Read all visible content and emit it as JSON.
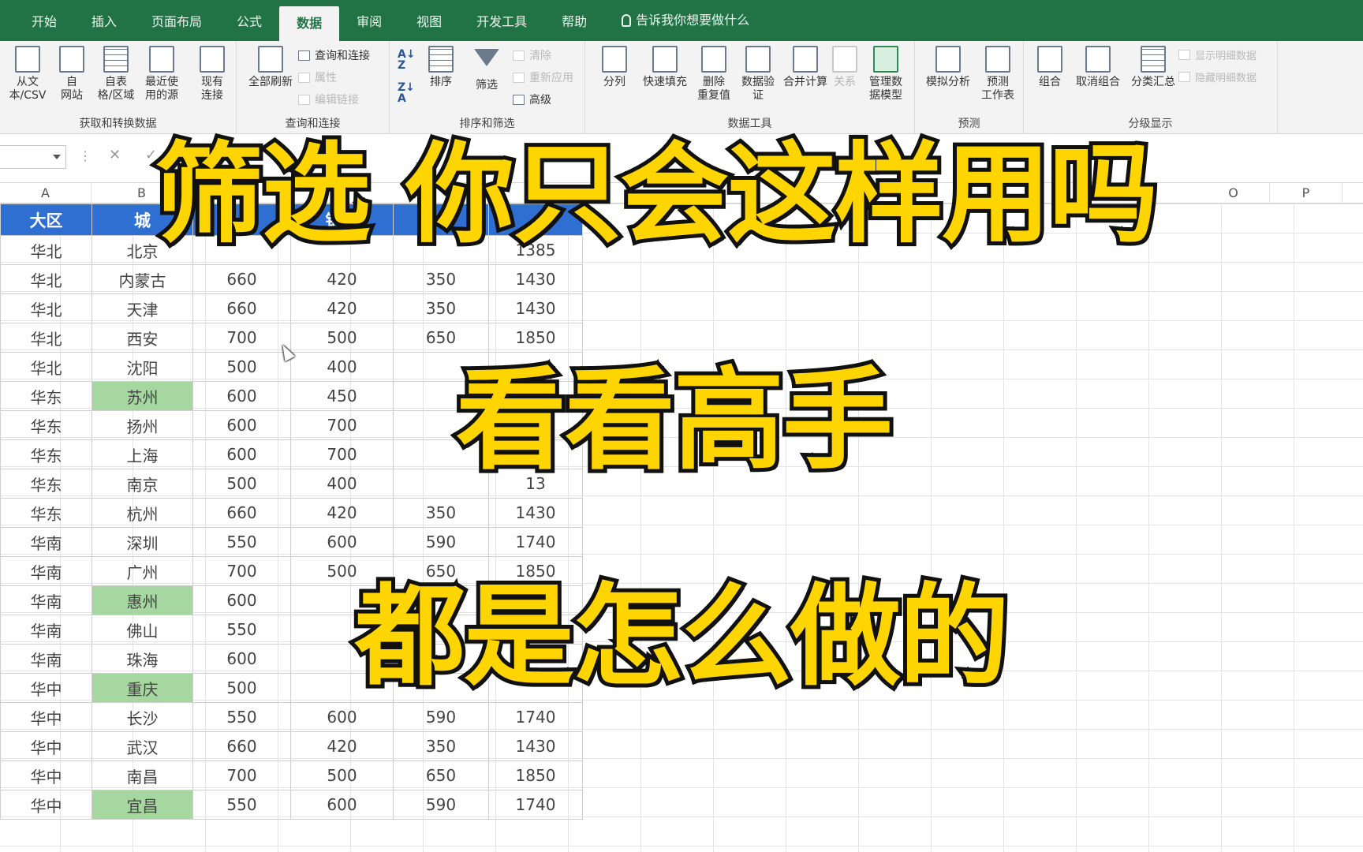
{
  "ribbon_tabs": [
    "开始",
    "插入",
    "页面布局",
    "公式",
    "数据",
    "审阅",
    "视图",
    "开发工具",
    "帮助"
  ],
  "tell_me": "告诉我你想要做什么",
  "ribbon": {
    "get_data": {
      "label": "获取和转换数据",
      "b1": "从文\n本/CSV",
      "b2": "自\n网站",
      "b3": "自表\n格/区域",
      "b4": "最近使\n用的源",
      "b5": "现有\n连接"
    },
    "queries": {
      "label": "查询和连接",
      "refresh_all": "全部刷新",
      "queries_conn": "查询和连接",
      "properties": "属性",
      "edit_links": "编辑链接"
    },
    "sort_filter": {
      "label": "排序和筛选",
      "sort": "排序",
      "filter": "筛选",
      "clear": "清除",
      "reapply": "重新应用",
      "advanced": "高级"
    },
    "data_tools": {
      "label": "数据工具",
      "text_to_cols": "分列",
      "flash_fill": "快速填充",
      "remove_dup": "删除\n重复值",
      "validation": "数据验\n证",
      "consolidate": "合并计算",
      "relationships": "关系",
      "data_model": "管理数\n据模型"
    },
    "forecast": {
      "label": "预测",
      "what_if": "模拟分析",
      "forecast_sheet": "预测\n工作表"
    },
    "outline": {
      "label": "分级显示",
      "group": "组合",
      "ungroup": "取消组合",
      "subtotal": "分类汇总",
      "show_detail": "显示明细数据",
      "hide_detail": "隐藏明细数据"
    }
  },
  "column_letters": {
    "A": "A",
    "B": "B",
    "O": "O",
    "P": "P"
  },
  "table": {
    "headers": [
      "大区",
      "城",
      "",
      "销售",
      "",
      ""
    ],
    "rows": [
      [
        "华北",
        "北京",
        "",
        "",
        "",
        "1385"
      ],
      [
        "华北",
        "内蒙古",
        "660",
        "420",
        "350",
        "1430"
      ],
      [
        "华北",
        "天津",
        "660",
        "420",
        "350",
        "1430"
      ],
      [
        "华北",
        "西安",
        "700",
        "500",
        "650",
        "1850"
      ],
      [
        "华北",
        "沈阳",
        "500",
        "400",
        "",
        ""
      ],
      [
        "华东",
        "苏州",
        "600",
        "450",
        "",
        ""
      ],
      [
        "华东",
        "扬州",
        "600",
        "700",
        "",
        ""
      ],
      [
        "华东",
        "上海",
        "600",
        "700",
        "",
        ""
      ],
      [
        "华东",
        "南京",
        "500",
        "400",
        "",
        "13"
      ],
      [
        "华东",
        "杭州",
        "660",
        "420",
        "350",
        "1430"
      ],
      [
        "华南",
        "深圳",
        "550",
        "600",
        "590",
        "1740"
      ],
      [
        "华南",
        "广州",
        "700",
        "500",
        "650",
        "1850"
      ],
      [
        "华南",
        "惠州",
        "600",
        "",
        "",
        "14"
      ],
      [
        "华南",
        "佛山",
        "550",
        "",
        "",
        ""
      ],
      [
        "华南",
        "珠海",
        "600",
        "",
        "",
        ""
      ],
      [
        "华中",
        "重庆",
        "500",
        "",
        "",
        ""
      ],
      [
        "华中",
        "长沙",
        "550",
        "600",
        "590",
        "1740"
      ],
      [
        "华中",
        "武汉",
        "660",
        "420",
        "350",
        "1430"
      ],
      [
        "华中",
        "南昌",
        "700",
        "500",
        "650",
        "1850"
      ],
      [
        "华中",
        "宜昌",
        "550",
        "600",
        "590",
        "1740"
      ]
    ],
    "red_cities": [
      "西安",
      "上海",
      "深圳",
      "佛山",
      "武汉"
    ],
    "green_cities": [
      "苏州",
      "惠州",
      "重庆",
      "宜昌"
    ]
  },
  "overlay": {
    "line1": "筛选 你只会这样用吗",
    "line2": "看看高手",
    "line3": "都是怎么做的"
  },
  "colors": {
    "excel_green": "#217346",
    "header_blue": "#2e6fd1",
    "highlight_green": "#a6d7a0",
    "red_text": "#d9453a",
    "overlay_yellow": "#ffd500"
  }
}
